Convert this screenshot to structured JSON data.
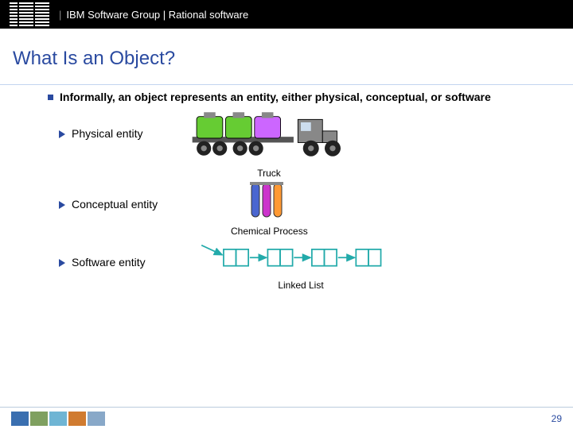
{
  "header": {
    "logo_alt": "IBM",
    "group_text": "IBM Software Group | Rational software"
  },
  "title": "What Is an Object?",
  "main_bullet": "Informally, an object represents an entity, either physical, conceptual, or software",
  "entities": [
    {
      "label": "Physical entity",
      "caption": "Truck"
    },
    {
      "label": "Conceptual entity",
      "caption": "Chemical Process"
    },
    {
      "label": "Software entity",
      "caption": "Linked List"
    }
  ],
  "page_number": "29"
}
